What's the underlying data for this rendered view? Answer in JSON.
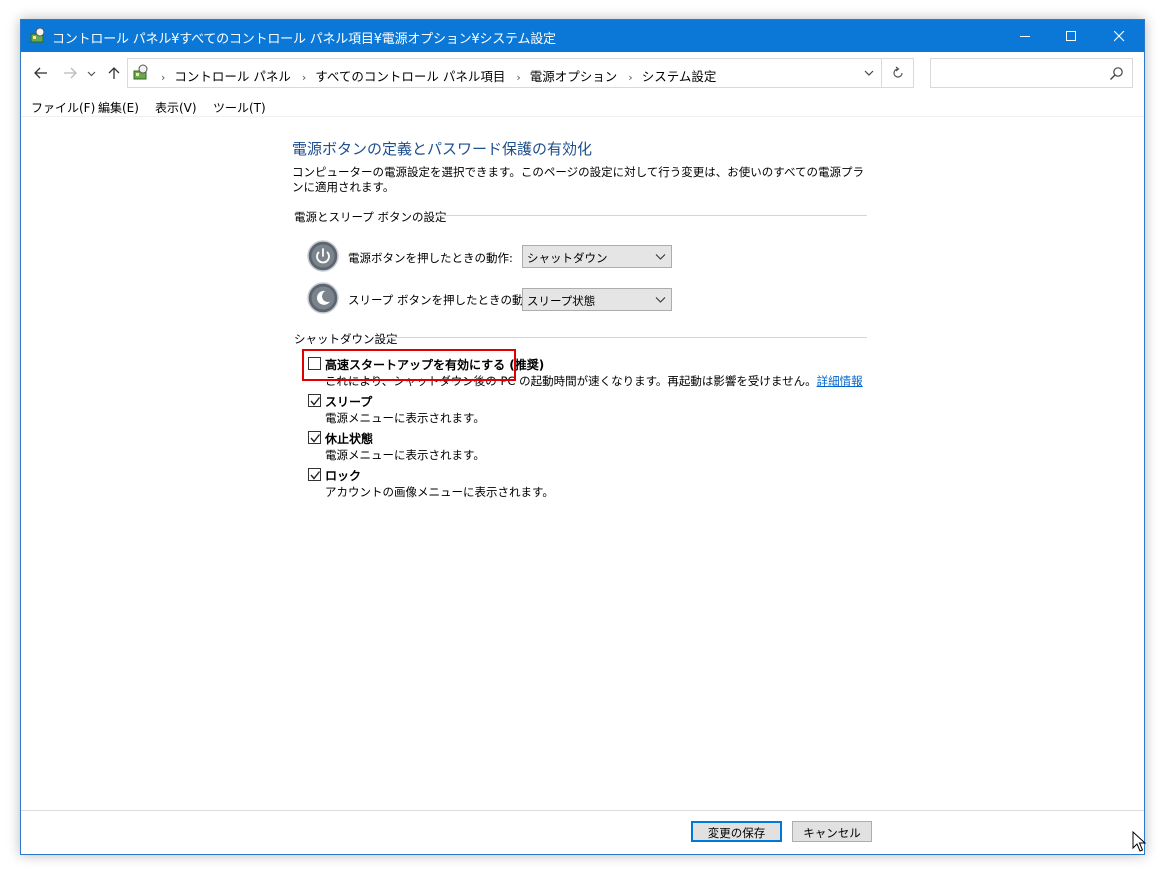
{
  "window": {
    "title": "コントロール パネル¥すべてのコントロール パネル項目¥電源オプション¥システム設定",
    "accent_color": "#0b78d7"
  },
  "address": {
    "breadcrumbs": [
      "コントロール パネル",
      "すべてのコントロール パネル項目",
      "電源オプション",
      "システム設定"
    ],
    "search_placeholder": ""
  },
  "menu": [
    "ファイル(F)",
    "編集(E)",
    "表示(V)",
    "ツール(T)"
  ],
  "page": {
    "title": "電源ボタンの定義とパスワード保護の有効化",
    "description": "コンピューターの電源設定を選択できます。このページの設定に対して行う変更は、お使いのすべての電源プランに適用されます。",
    "power_group": {
      "label": "電源とスリープ ボタンの設定",
      "power_button": {
        "label": "電源ボタンを押したときの動作:",
        "value": "シャットダウン"
      },
      "sleep_button": {
        "label": "スリープ ボタンを押したときの動作:",
        "value": "スリープ状態"
      }
    },
    "shutdown_group": {
      "label": "シャットダウン設定",
      "options": [
        {
          "title": "高速スタートアップを有効にする (推奨)",
          "description": "これにより、シャットダウン後の PC の起動時間が速くなります。再起動は影響を受けません。",
          "link": "詳細情報",
          "checked": false
        },
        {
          "title": "スリープ",
          "description": "電源メニューに表示されます。",
          "checked": true
        },
        {
          "title": "休止状態",
          "description": "電源メニューに表示されます。",
          "checked": true
        },
        {
          "title": "ロック",
          "description": "アカウントの画像メニューに表示されます。",
          "checked": true
        }
      ]
    }
  },
  "footer": {
    "save_label": "変更の保存",
    "cancel_label": "キャンセル"
  }
}
